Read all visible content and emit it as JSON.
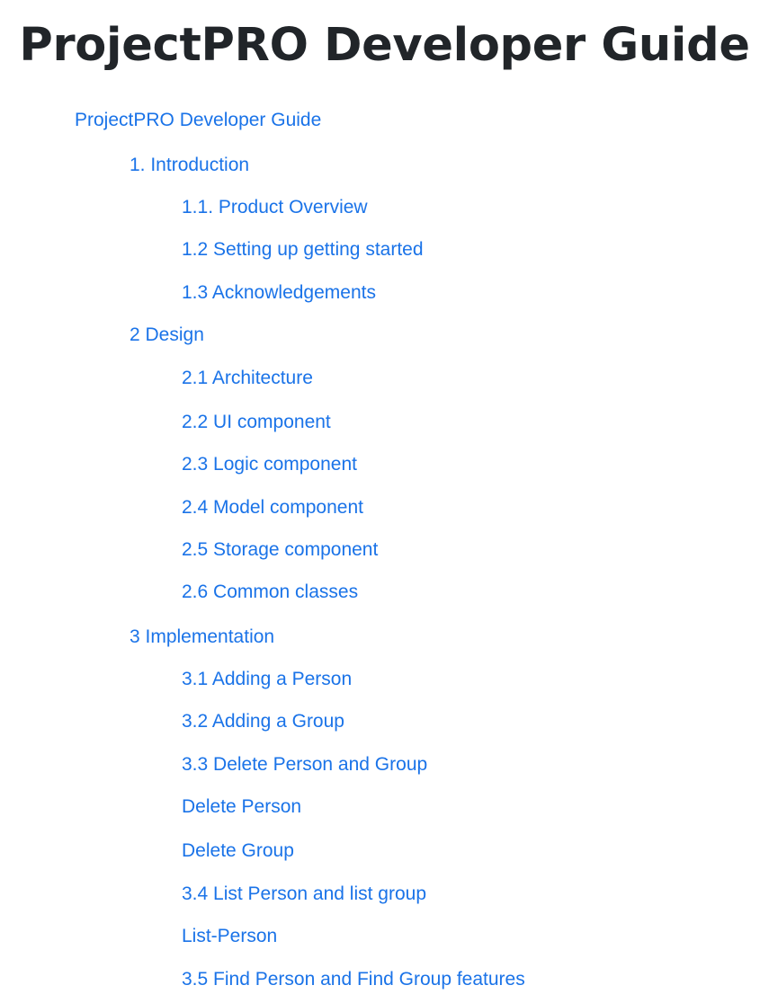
{
  "page_title": "ProjectPRO Developer Guide",
  "toc": [
    {
      "label": "ProjectPRO Developer Guide",
      "level": 0
    },
    {
      "label": "1. Introduction",
      "level": 1
    },
    {
      "label": "1.1. Product Overview",
      "level": 2
    },
    {
      "label": "1.2 Setting up getting started",
      "level": 2
    },
    {
      "label": "1.3 Acknowledgements",
      "level": 2
    },
    {
      "label": "2 Design",
      "level": 1
    },
    {
      "label": "2.1 Architecture",
      "level": 2
    },
    {
      "label": "2.2 UI component",
      "level": 2
    },
    {
      "label": "2.3 Logic component",
      "level": 2
    },
    {
      "label": "2.4 Model component",
      "level": 2
    },
    {
      "label": "2.5 Storage component",
      "level": 2
    },
    {
      "label": "2.6 Common classes",
      "level": 2
    },
    {
      "label": "3 Implementation",
      "level": 1
    },
    {
      "label": "3.1 Adding a Person",
      "level": 2
    },
    {
      "label": "3.2 Adding a Group",
      "level": 2
    },
    {
      "label": "3.3 Delete Person and Group",
      "level": 2
    },
    {
      "label": "Delete Person",
      "level": 2
    },
    {
      "label": "Delete Group",
      "level": 2
    },
    {
      "label": "3.4 List Person and list group",
      "level": 2
    },
    {
      "label": "List-Person",
      "level": 2
    },
    {
      "label": "3.5 Find Person and Find Group features",
      "level": 2
    }
  ],
  "colors": {
    "title": "#212529",
    "link": "#1a73e8",
    "background": "#ffffff"
  }
}
